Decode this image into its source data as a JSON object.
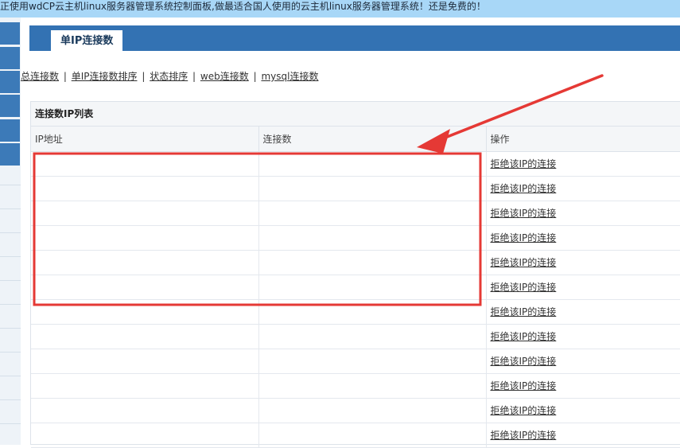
{
  "banner": {
    "text": "正使用wdCP云主机linux服务器管理系统控制面板,做最适合国人使用的云主机linux服务器管理系统！还是免费的！"
  },
  "page": {
    "tab_title": "单IP连接数"
  },
  "subnav": {
    "items": [
      "总连接数",
      "单IP连接数排序",
      "状态排序",
      "web连接数",
      "mysql连接数"
    ],
    "separator": "|"
  },
  "panel": {
    "title": "连接数IP列表",
    "columns": [
      "IP地址",
      "连接数",
      "操作"
    ],
    "rows": [
      {
        "ip": "",
        "count": "",
        "action": "拒绝该IP的连接"
      },
      {
        "ip": "",
        "count": "",
        "action": "拒绝该IP的连接"
      },
      {
        "ip": "",
        "count": "",
        "action": "拒绝该IP的连接"
      },
      {
        "ip": "",
        "count": "",
        "action": "拒绝该IP的连接"
      },
      {
        "ip": "",
        "count": "",
        "action": "拒绝该IP的连接"
      },
      {
        "ip": "",
        "count": "",
        "action": "拒绝该IP的连接"
      },
      {
        "ip": "",
        "count": "",
        "action": "拒绝该IP的连接"
      },
      {
        "ip": "",
        "count": "",
        "action": "拒绝该IP的连接"
      },
      {
        "ip": "",
        "count": "",
        "action": "拒绝该IP的连接"
      },
      {
        "ip": "",
        "count": "",
        "action": "拒绝该IP的连接"
      },
      {
        "ip": "",
        "count": "",
        "action": "拒绝该IP的连接"
      },
      {
        "ip": "",
        "count": "",
        "action": "拒绝该IP的连接"
      }
    ]
  },
  "annotation": {
    "color": "#e53935"
  },
  "colors": {
    "banner_bg": "#a8d7f7",
    "title_bar": "#3372b3",
    "nav_block": "#3c7ab8"
  }
}
